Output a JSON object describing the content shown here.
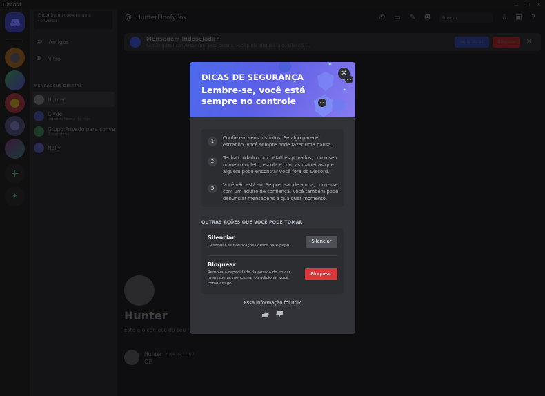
{
  "window": {
    "title": "Discord",
    "controls": [
      "—",
      "☐",
      "✕"
    ]
  },
  "colors": {
    "accent": "#5865f2",
    "danger": "#da373c",
    "modal_bg": "#313338",
    "panel_bg": "#2b2d31"
  },
  "sidebar": {
    "search_placeholder": "Encontre ou comece uma conversa",
    "nav": [
      {
        "label": "Amigos",
        "icon": "friends-icon"
      },
      {
        "label": "Nitro",
        "icon": "nitro-icon"
      }
    ],
    "section_title": "MENSAGENS DIRETAS",
    "dms": [
      {
        "name": "Hunter",
        "sub": ""
      },
      {
        "name": "Clyde",
        "sub": "Jogando Nome do Jogo"
      },
      {
        "name": "Grupo Privado para conver...",
        "sub": "3 membros"
      },
      {
        "name": "Nelly",
        "sub": ""
      }
    ]
  },
  "header": {
    "name": "HunterFloofyFox",
    "search_placeholder": "Buscar"
  },
  "banner": {
    "title": "Mensagem indesejada?",
    "subtitle": "Se não quiser conversar com essa pessoa, você pode bloqueá-la ou silenciá-la.",
    "more_label": "Mais dicas",
    "block_label": "Bloquear"
  },
  "chat": {
    "name": "Hunter",
    "intro": "Este é o começo do seu histórico de mensagens diretas com Hunter.",
    "message": {
      "author": "Hunter",
      "time": "Hoje às 12:00",
      "text": "Oi!"
    }
  },
  "modal": {
    "kicker": "DICAS DE SEGURANÇA",
    "headline": "Lembre-se, você está sempre no controle",
    "tips": [
      {
        "num": "1",
        "text": "Confie em seus instintos. Se algo parecer estranho, você sempre pode fazer uma pausa."
      },
      {
        "num": "2",
        "text": "Tenha cuidado com detalhes privados, como seu nome completo, escola e com as maneiras que alguém pode encontrar você fora do Discord."
      },
      {
        "num": "3",
        "text": "Você não está só. Se precisar de ajuda, converse com um adulto de confiança. Você também pode denunciar mensagens a qualquer momento."
      }
    ],
    "other_actions_title": "OUTRAS AÇÕES QUE VOCÊ PODE TOMAR",
    "actions": {
      "mute": {
        "title": "Silenciar",
        "desc": "Desativar as notificações deste bate-papo.",
        "button": "Silenciar"
      },
      "block": {
        "title": "Bloquear",
        "desc": "Remova a capacidade da pessoa de enviar mensagens, mencionar ou adicionar você como amigo.",
        "button": "Bloquear"
      }
    },
    "feedback_question": "Essa informação foi útil?"
  }
}
